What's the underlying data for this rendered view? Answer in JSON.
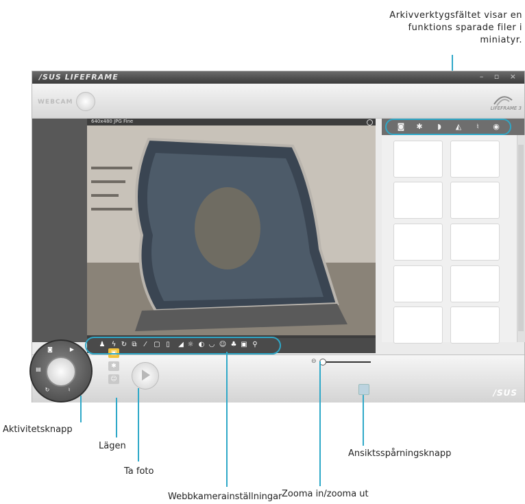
{
  "callouts": {
    "archive_bar": "Arkivverktygsfältet visar en funktions sparade filer i miniatyr.",
    "activity_button": "Aktivitetsknapp",
    "modes": "Lägen",
    "take_photo": "Ta foto",
    "webcam_settings": "Webbkamerainställningar",
    "zoom": "Zooma in/zooma ut",
    "face_tracking": "Ansiktsspårningsknapp"
  },
  "app": {
    "brand": "/SUS LIFEFRAME",
    "window_controls": "– ▫ ×",
    "webcam_label": "WEBCAM",
    "logo_text": "LIFEFRAME 3",
    "resolution_label": "640x480 JPG Fine",
    "footer_brand": "/SUS"
  },
  "archive_icons": [
    "camera-icon",
    "snowflake-icon",
    "face-icon",
    "video-camera-icon",
    "microphone-icon",
    "eye-icon"
  ],
  "toolbar_icons": [
    "person-icon",
    "flash-icon",
    "timer-icon",
    "burst-icon",
    "ruler-icon",
    "frame-icon",
    "frame-icon",
    "contrast-icon",
    "brightness-icon",
    "half-circle-icon",
    "cup-icon",
    "face-icon",
    "people-icon",
    "photo-icon",
    "wrench-icon"
  ],
  "thumbnail_count": 10,
  "colors": {
    "leader": "#2ea8c8",
    "titlebar": "#4a4a4a"
  }
}
